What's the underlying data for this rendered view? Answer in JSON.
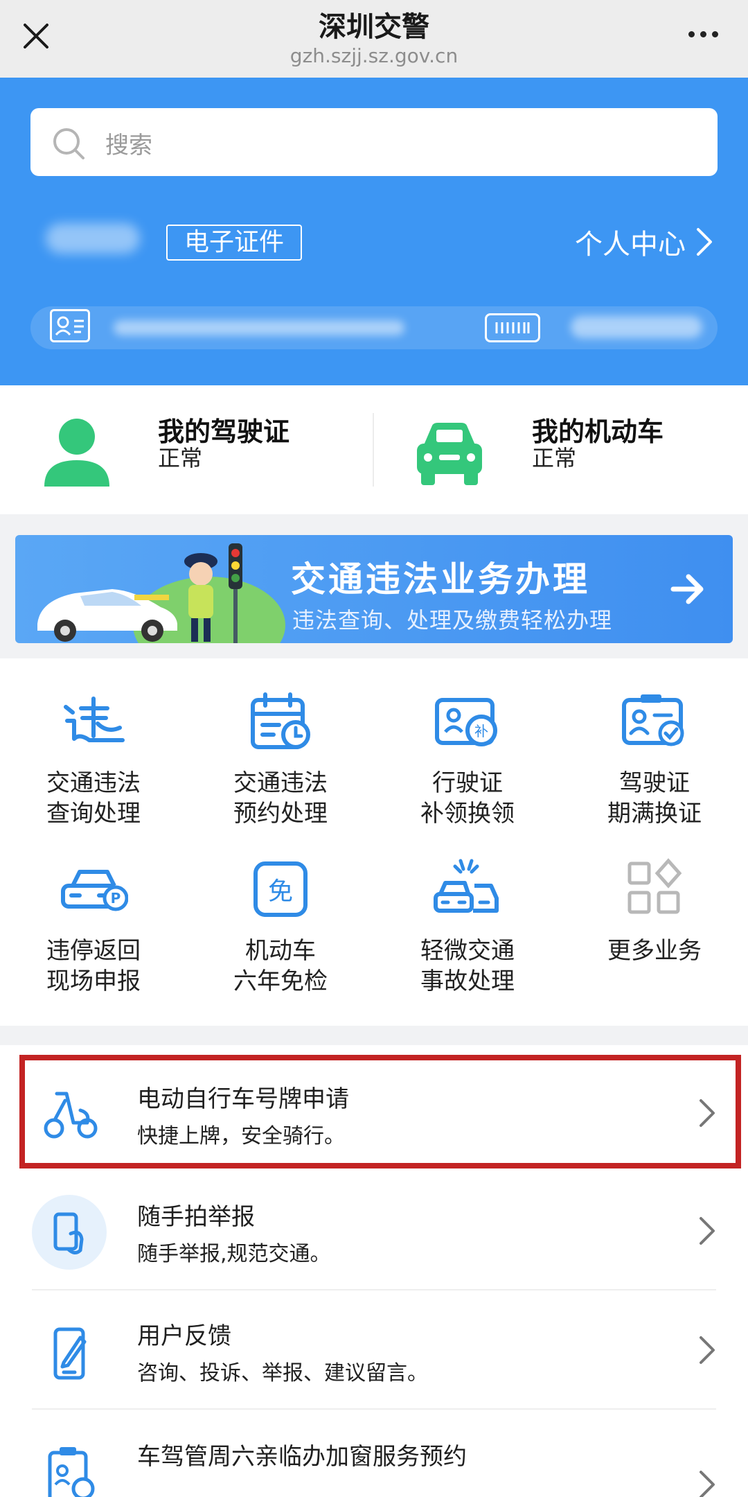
{
  "header": {
    "title": "深圳交警",
    "url": "gzh.szjj.sz.gov.cn",
    "close_icon": "close-icon",
    "more_icon": "more-dots-icon"
  },
  "search": {
    "placeholder": "搜索",
    "icon": "search-icon"
  },
  "profile": {
    "ecert_label": "电子证件",
    "center_label": "个人中心"
  },
  "status": {
    "license": {
      "title": "我的驾驶证",
      "value": "正常",
      "icon": "person-icon"
    },
    "vehicle": {
      "title": "我的机动车",
      "value": "正常",
      "icon": "car-icon"
    }
  },
  "banner": {
    "title": "交通违法业务办理",
    "subtitle": "违法查询、处理及缴费轻松办理"
  },
  "services": [
    {
      "label1": "交通违法",
      "label2": "查询处理",
      "icon": "violation-icon"
    },
    {
      "label1": "交通违法",
      "label2": "预约处理",
      "icon": "calendar-icon"
    },
    {
      "label1": "行驶证",
      "label2": "补领换领",
      "icon": "vehicle-license-icon"
    },
    {
      "label1": "驾驶证",
      "label2": "期满换证",
      "icon": "driver-license-icon"
    },
    {
      "label1": "违停返回",
      "label2": "现场申报",
      "icon": "parking-car-icon"
    },
    {
      "label1": "机动车",
      "label2": "六年免检",
      "icon": "exempt-icon"
    },
    {
      "label1": "轻微交通",
      "label2": "事故处理",
      "icon": "accident-icon"
    },
    {
      "label1": "更多业务",
      "label2": "",
      "icon": "grid-more-icon"
    }
  ],
  "list": [
    {
      "title": "电动自行车号牌申请",
      "subtitle": "快捷上牌，安全骑行。",
      "icon": "scooter-icon"
    },
    {
      "title": "随手拍举报",
      "subtitle": "随手举报,规范交通。",
      "icon": "phone-report-icon"
    },
    {
      "title": "用户反馈",
      "subtitle": "咨询、投诉、举报、建议留言。",
      "icon": "feedback-icon"
    },
    {
      "title": "车驾管周六亲临办加窗服务预约",
      "subtitle": "",
      "icon": "appointment-icon"
    }
  ],
  "colors": {
    "blue": "#3d96f3",
    "green": "#34c77b",
    "icon_blue": "#2f8be6",
    "highlight_red": "#c32323"
  }
}
